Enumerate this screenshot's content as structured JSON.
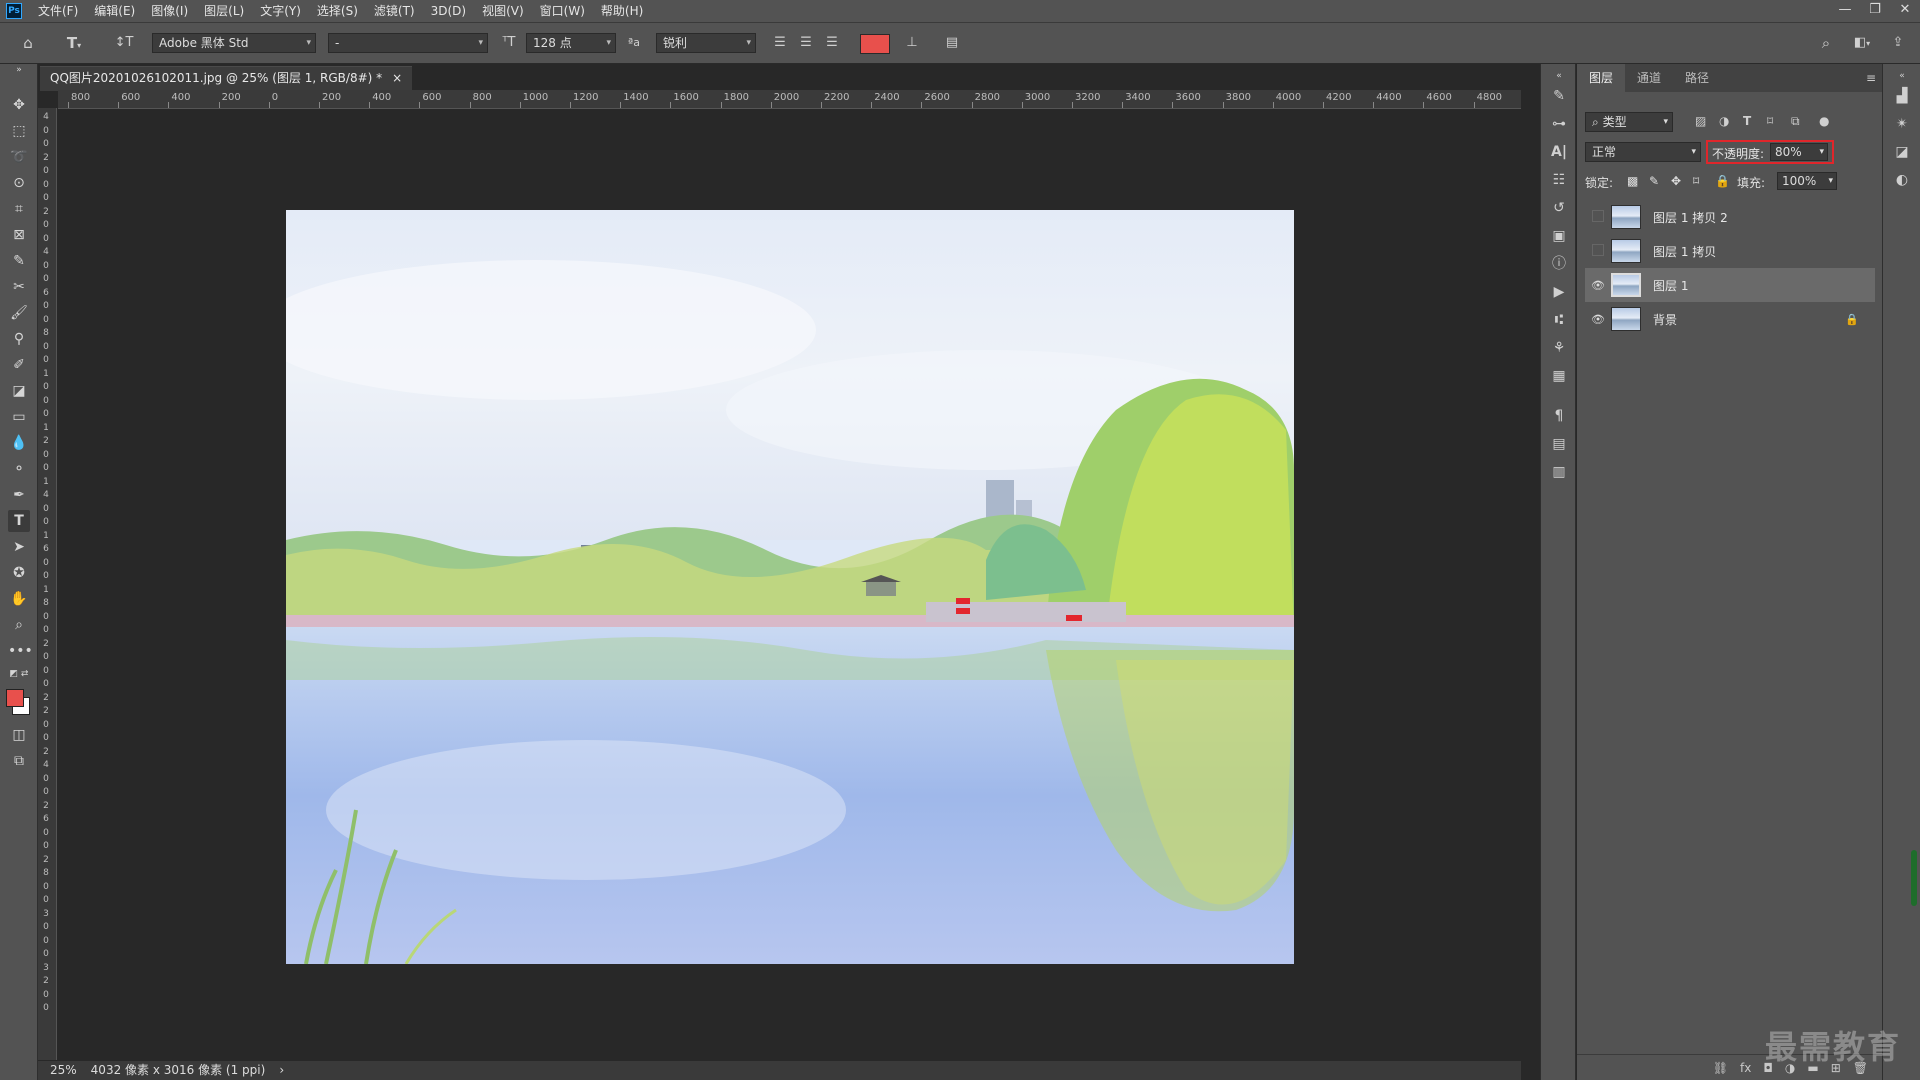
{
  "menu": {
    "logo": "Ps",
    "items": [
      "文件(F)",
      "编辑(E)",
      "图像(I)",
      "图层(L)",
      "文字(Y)",
      "选择(S)",
      "滤镜(T)",
      "3D(D)",
      "视图(V)",
      "窗口(W)",
      "帮助(H)"
    ]
  },
  "window_controls": {
    "minimize": "—",
    "restore": "❐",
    "close": "✕"
  },
  "options": {
    "font_family": "Adobe 黑体 Std",
    "font_style": "-",
    "font_size": "128 点",
    "antialias": "锐利",
    "text_color": "#e8504c"
  },
  "document": {
    "tab_title": "QQ图片20201026102011.jpg @ 25% (图层 1, RGB/8#) *",
    "close_label": "×"
  },
  "ruler": {
    "h_labels": [
      "800",
      "600",
      "400",
      "200",
      "0",
      "200",
      "400",
      "600",
      "800",
      "1000",
      "1200",
      "1400",
      "1600",
      "1800",
      "2000",
      "2200",
      "2400",
      "2600",
      "2800",
      "3000",
      "3200",
      "3400",
      "3600",
      "3800",
      "4000",
      "4200",
      "4400",
      "4600",
      "4800"
    ],
    "v_labels": [
      "4",
      "0",
      "0",
      "2",
      "0",
      "0",
      "0",
      "2",
      "0",
      "0",
      "4",
      "0",
      "0",
      "6",
      "0",
      "0",
      "8",
      "0",
      "0",
      "1",
      "0",
      "0",
      "0",
      "1",
      "2",
      "0",
      "0",
      "1",
      "4",
      "0",
      "0",
      "1",
      "6",
      "0",
      "0",
      "1",
      "8",
      "0",
      "0",
      "2",
      "0",
      "0",
      "0",
      "2",
      "2",
      "0",
      "0",
      "2",
      "4",
      "0",
      "0",
      "2",
      "6",
      "0",
      "0",
      "2",
      "8",
      "0",
      "0",
      "3",
      "0",
      "0",
      "0",
      "3",
      "2",
      "0",
      "0"
    ]
  },
  "status": {
    "zoom": "25%",
    "info": "4032 像素 x 3016 像素 (1 ppi)",
    "arrow": "›"
  },
  "panel": {
    "tabs": [
      "图层",
      "通道",
      "路径"
    ],
    "filter_kind": "类型",
    "blend_mode": "正常",
    "opacity_label": "不透明度:",
    "opacity_value": "80%",
    "lock_label": "锁定:",
    "fill_label": "填充:",
    "fill_value": "100%",
    "highlight_color": "#e0262b",
    "layers": [
      {
        "name": "图层 1 拷贝 2",
        "visible": false,
        "selected": false,
        "locked": false
      },
      {
        "name": "图层 1 拷贝",
        "visible": false,
        "selected": false,
        "locked": false
      },
      {
        "name": "图层 1",
        "visible": true,
        "selected": true,
        "locked": false
      },
      {
        "name": "背景",
        "visible": true,
        "selected": false,
        "locked": true
      }
    ]
  },
  "colors": {
    "foreground": "#e8504c",
    "background": "#ffffff"
  },
  "watermark": "最需教育"
}
